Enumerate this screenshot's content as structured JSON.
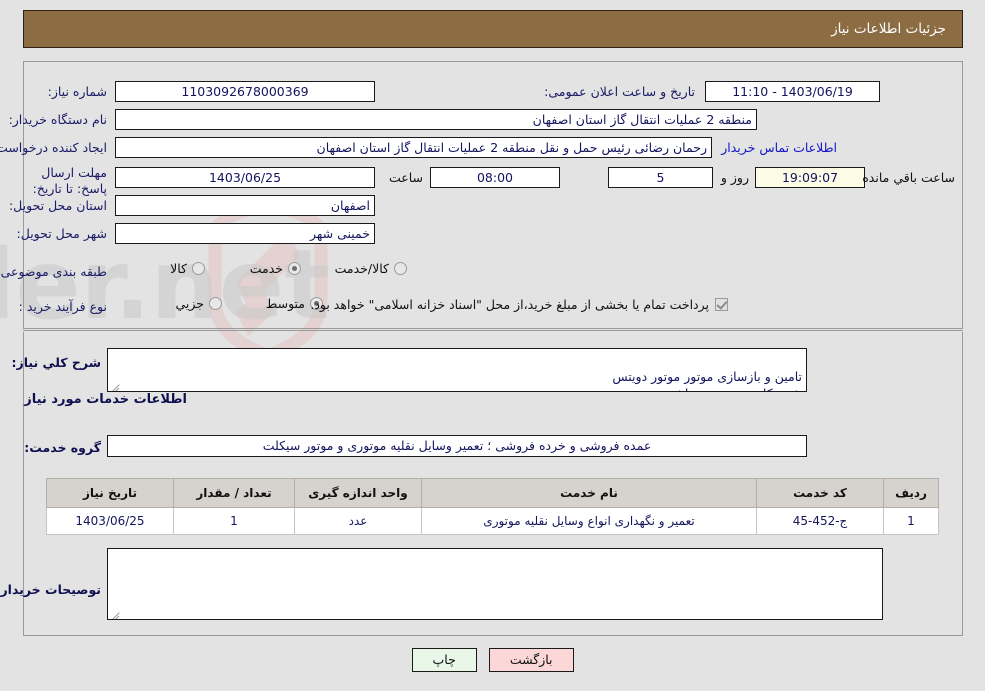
{
  "header": {
    "title": "جزئیات اطلاعات نیاز",
    "bg_color": "#8b6c43",
    "text_color": "#ffffff"
  },
  "watermark": {
    "text": "AriaTender.net",
    "shield_color": "#e9c3c3",
    "text_color": "#cfcfcf"
  },
  "form": {
    "need_number": {
      "label": "شماره نیاز:",
      "value": "1103092678000369"
    },
    "announce_datetime": {
      "label": "تاریخ و ساعت اعلان عمومی:",
      "value": "1403/06/19 - 11:10"
    },
    "buyer_org": {
      "label": "نام دستگاه خریدار:",
      "value": "منطقه 2 عملیات انتقال گاز استان اصفهان"
    },
    "request_creator": {
      "label": "ایجاد کننده درخواست:",
      "value": "رحمان رضائی رئیس حمل و نقل منطقه 2 عملیات انتقال گاز استان اصفهان"
    },
    "contact_link": "اطلاعات تماس خریدار",
    "deadline": {
      "label": "مهلت ارسال پاسخ: تا تاریخ:",
      "date": "1403/06/25",
      "time_label": "ساعت",
      "time": "08:00",
      "days": "5",
      "days_label": "روز و",
      "countdown": "19:09:07",
      "countdown_label": "ساعت باقي مانده"
    },
    "delivery_province": {
      "label": "استان محل تحویل:",
      "value": "اصفهان"
    },
    "delivery_city": {
      "label": "شهر محل تحویل:",
      "value": "خمینی شهر"
    },
    "category": {
      "label": "طبقه بندی موضوعی:",
      "options": [
        {
          "label": "کالا",
          "selected": false
        },
        {
          "label": "خدمت",
          "selected": true
        },
        {
          "label": "کالا/خدمت",
          "selected": false
        }
      ]
    },
    "purchase_process": {
      "label": "نوع فرآیند خرید :",
      "options": [
        {
          "label": "جزیي",
          "selected": false
        },
        {
          "label": "متوسط",
          "selected": true
        }
      ]
    },
    "treasury_note": {
      "checked": true,
      "text": "پرداخت تمام یا بخشی از مبلغ خرید،از محل \"اسناد خزانه اسلامی\" خواهد بود."
    },
    "general_description": {
      "label": "شرح کلي نیاز:",
      "value": "تامین و بازسازی موتور موتور دویتس\nشرح کار ضمیمه می باشد"
    },
    "services_section_heading": "اطلاعات خدمات مورد نیاز",
    "service_group": {
      "label": "گروه خدمت:",
      "value": "عمده فروشی و خرده فروشی ؛ تعمیر وسایل نقلیه موتوری و موتور سیکلت"
    },
    "buyer_comments": {
      "label": "توصیحات خریدار:",
      "value": ""
    }
  },
  "table": {
    "columns": [
      "ردیف",
      "کد خدمت",
      "نام خدمت",
      "واحد اندازه گیری",
      "تعداد / مقدار",
      "تاریخ نیاز"
    ],
    "rows": [
      {
        "row": "1",
        "service_code": "ج-452-45",
        "service_name": "تعمیر و نگهداری انواع وسایل نقلیه موتوری",
        "unit": "عدد",
        "quantity": "1",
        "need_date": "1403/06/25"
      }
    ]
  },
  "buttons": {
    "print": "چاپ",
    "back": "بازگشت"
  }
}
